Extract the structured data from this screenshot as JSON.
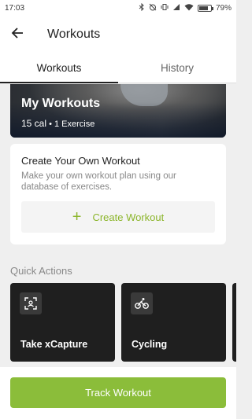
{
  "status_bar": {
    "time": "17:03",
    "battery": "79%",
    "battery_level": 0.79
  },
  "app_bar": {
    "title": "Workouts"
  },
  "tabs": [
    {
      "label": "Workouts",
      "active": true
    },
    {
      "label": "History",
      "active": false
    }
  ],
  "hero": {
    "title": "My Workouts",
    "calories": "15 cal",
    "exercises": "• 1 Exercise"
  },
  "create_card": {
    "title": "Create Your Own Workout",
    "description": "Make your own workout plan using our database of exercises.",
    "button_label": "Create Workout",
    "accent": "#8bb52a"
  },
  "quick_actions": {
    "label": "Quick Actions",
    "items": [
      {
        "label": "Take xCapture",
        "icon": "capture-icon"
      },
      {
        "label": "Cycling",
        "icon": "cycling-icon"
      }
    ]
  },
  "track_button": {
    "label": "Track Workout",
    "color": "#8bbd3a"
  }
}
